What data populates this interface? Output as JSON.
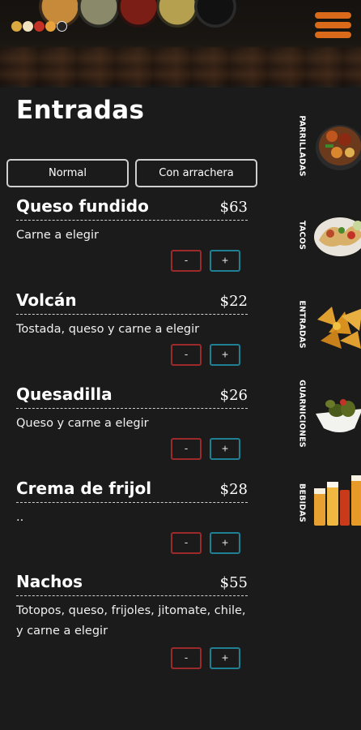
{
  "header": {
    "dots": [
      {
        "color": "#d9a840"
      },
      {
        "color": "#f2e3c0"
      },
      {
        "color": "#c23226"
      },
      {
        "color": "#e8a23c"
      },
      {
        "color": "#3a3a3a"
      }
    ],
    "bowls": [
      {
        "color": "#c78a3a"
      },
      {
        "color": "#8a8a6a"
      },
      {
        "color": "#7a1e16"
      },
      {
        "color": "#b5a050"
      },
      {
        "color": "#111111"
      }
    ],
    "accent": "#d86a1a"
  },
  "section_title": "Entradas",
  "options": [
    "Normal",
    "Con arrachera"
  ],
  "items": [
    {
      "name": "Queso fundido",
      "price": "$63",
      "desc": "Carne a elegir"
    },
    {
      "name": "Volcán",
      "price": "$22",
      "desc": "Tostada, queso y carne a elegir"
    },
    {
      "name": "Quesadilla",
      "price": "$26",
      "desc": "Queso y carne a elegir"
    },
    {
      "name": "Crema de frijol",
      "price": "$28",
      "desc": ".."
    },
    {
      "name": "Nachos",
      "price": "$55",
      "desc": "Totopos, queso, frijoles, jitomate, chile, y carne a elegir"
    }
  ],
  "qty": {
    "minus": "-",
    "plus": "+"
  },
  "categories": [
    {
      "label": "PARRILLADAS",
      "icon": "grill-platter-icon"
    },
    {
      "label": "TACOS",
      "icon": "tacos-icon"
    },
    {
      "label": "ENTRADAS",
      "icon": "nachos-icon"
    },
    {
      "label": "GUARNICIONES",
      "icon": "side-dish-icon"
    },
    {
      "label": "BEBIDAS",
      "icon": "drinks-icon"
    }
  ]
}
